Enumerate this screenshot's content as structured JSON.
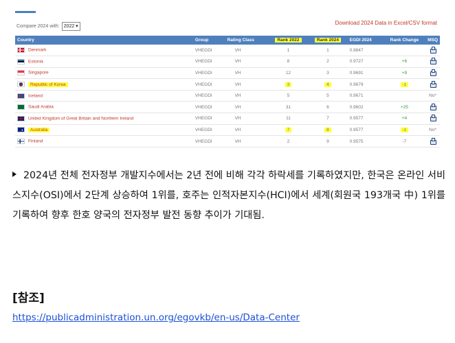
{
  "compare": {
    "label": "Compare 2024 with:",
    "selected": "2022"
  },
  "download_link": "Download 2024 Data in Excel/CSV format",
  "table": {
    "headers": {
      "country": "Country",
      "group": "Group",
      "rating": "Rating Class",
      "rank2022": "Rank 2022",
      "rank2024": "Rank 2024",
      "egdi": "EGDI 2024",
      "change": "Rank Change",
      "msq": "MSQ"
    },
    "rows": [
      {
        "country": "Denmark",
        "group": "VHEGDI",
        "rating": "VH",
        "rank2022": "1",
        "rank2024": "1",
        "egdi": "0.9847",
        "change": "",
        "msq": "icon",
        "highlight": false
      },
      {
        "country": "Estonia",
        "group": "VHEGDI",
        "rating": "VH",
        "rank2022": "8",
        "rank2024": "2",
        "egdi": "0.9727",
        "change": "+6",
        "msq": "icon",
        "highlight": false
      },
      {
        "country": "Singapore",
        "group": "VHEGDI",
        "rating": "VH",
        "rank2022": "12",
        "rank2024": "3",
        "egdi": "0.9691",
        "change": "+9",
        "msq": "icon",
        "highlight": false
      },
      {
        "country": "Republic of Korea",
        "group": "VHEGDI",
        "rating": "VH",
        "rank2022": "3",
        "rank2024": "4",
        "egdi": "0.9679",
        "change": "-1",
        "msq": "icon",
        "highlight": true
      },
      {
        "country": "Iceland",
        "group": "VHEGDI",
        "rating": "VH",
        "rank2022": "5",
        "rank2024": "5",
        "egdi": "0.9671",
        "change": "",
        "msq": "No*",
        "highlight": false
      },
      {
        "country": "Saudi Arabia",
        "group": "VHEGDI",
        "rating": "VH",
        "rank2022": "31",
        "rank2024": "6",
        "egdi": "0.9602",
        "change": "+25",
        "msq": "icon",
        "highlight": false
      },
      {
        "country": "United Kingdom of Great Britain and Northern Ireland",
        "group": "VHEGDI",
        "rating": "VH",
        "rank2022": "11",
        "rank2024": "7",
        "egdi": "0.9577",
        "change": "+4",
        "msq": "icon",
        "highlight": false
      },
      {
        "country": "Australia",
        "group": "VHEGDI",
        "rating": "VH",
        "rank2022": "7",
        "rank2024": "8",
        "egdi": "0.9577",
        "change": "-1",
        "msq": "No*",
        "highlight": true
      },
      {
        "country": "Finland",
        "group": "VHEGDI",
        "rating": "VH",
        "rank2022": "2",
        "rank2024": "9",
        "egdi": "0.9575",
        "change": "-7",
        "msq": "icon",
        "highlight": false
      }
    ]
  },
  "paragraph": "2024년 전체 전자정부 개발지수에서는 2년 전에 비해 각각 하락세를 기록하였지만, 한국은 온라인 서비스지수(OSI)에서 2단계 상승하여 1위를, 호주는 인적자본지수(HCI)에서 세계(회원국 193개국 中) 1위를 기록하여 향후 한호 양국의 전자정부 발전 동향 추이가 기대됨.",
  "reference": {
    "title": "[참조]",
    "link": "https://publicadministration.un.org/egovkb/en-us/Data-Center"
  },
  "colors": {
    "header_bg": "#4f80bd",
    "highlight": "#ffff3a",
    "country_text": "#c0392b",
    "positive_change": "#2e9b3a",
    "link": "#1a4fd6"
  },
  "flags": [
    "denmark-flag",
    "estonia-flag",
    "singapore-flag",
    "korea-flag",
    "iceland-flag",
    "saudi-arabia-flag",
    "uk-flag",
    "australia-flag",
    "finland-flag"
  ]
}
